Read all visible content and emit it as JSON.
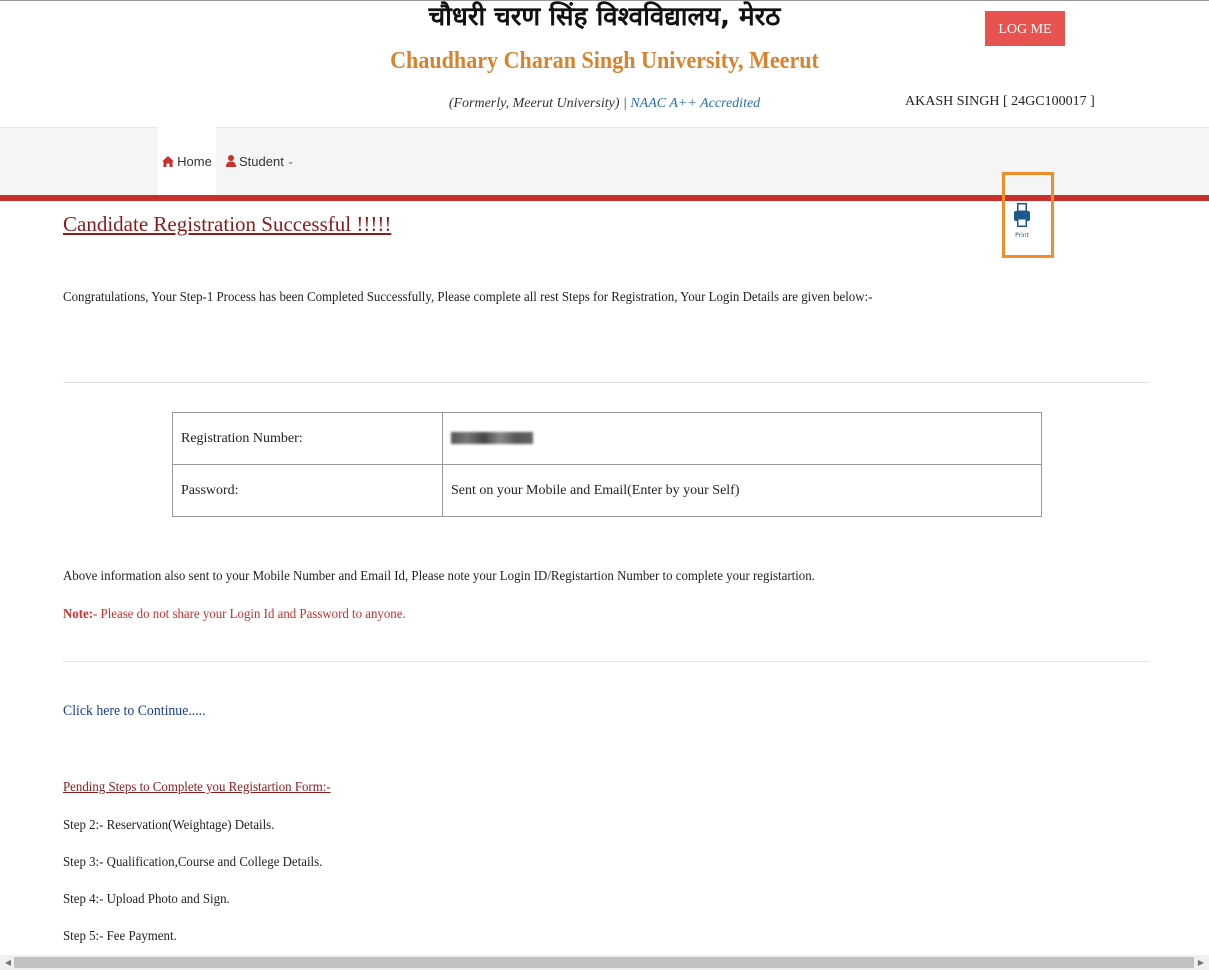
{
  "header": {
    "title_hindi": "चौधरी चरण सिंह विश्वविद्यालय, मेरठ",
    "title_english": "Chaudhary Charan Singh University, Meerut",
    "subtitle_prefix": "(Formerly, Meerut University) | ",
    "subtitle_accreditation": "NAAC A++ Accredited",
    "logout_label": "LOG ME OUT",
    "user_info": "AKASH SINGH [ 24GC100017 ]"
  },
  "nav": {
    "home_label": "Home",
    "student_label": "Student"
  },
  "print": {
    "label": "Print"
  },
  "main": {
    "heading": "Candidate Registration Successful !!!!!",
    "congrats": "Congratulations, Your Step-1 Process has been Completed Successfully, Please complete all rest Steps for Registration, Your Login Details are given below:-",
    "table": {
      "rows": [
        {
          "label": "Registration Number:",
          "value": "24GC100017"
        },
        {
          "label": "Password:",
          "value": "Sent on your Mobile and Email(Enter by your Self)"
        }
      ]
    },
    "info": "Above information also sent to your Mobile Number and Email Id, Please note your Login ID/Registartion Number to complete your registartion.",
    "note_prefix": "Note:-",
    "note_text": " Please do not share your Login Id and Password to anyone.",
    "continue_link": "Click here to Continue.....",
    "pending_heading": "Pending Steps to Complete you Registartion Form:-",
    "steps": [
      "Step 2:- Reservation(Weightage) Details.",
      "Step 3:- Qualification,Course and College Details.",
      "Step 4:- Upload Photo and Sign.",
      "Step 5:- Fee Payment."
    ]
  },
  "colors": {
    "brand_orange": "#d9822b",
    "logout_red": "#e8524f",
    "nav_red": "#c9302c",
    "heading_maroon": "#8b1a1a",
    "link_blue": "#1a3c9e"
  }
}
